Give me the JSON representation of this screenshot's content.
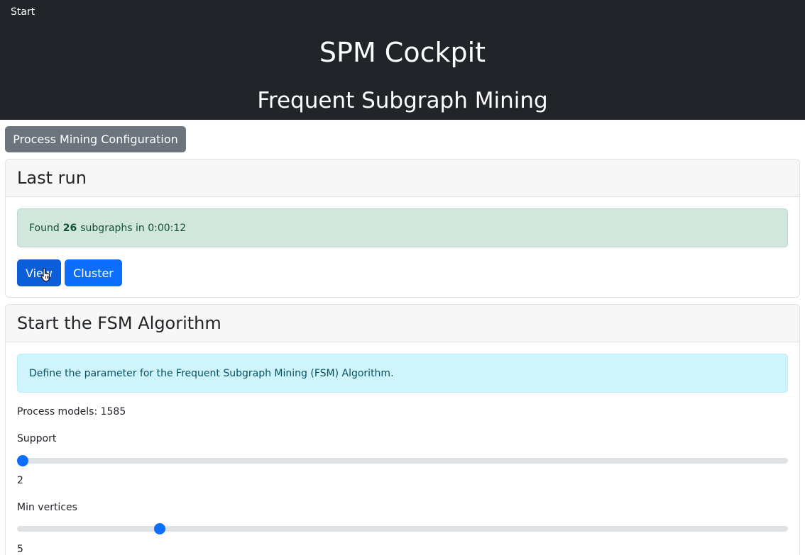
{
  "nav": {
    "start_label": "Start"
  },
  "header": {
    "title": "SPM Cockpit",
    "subtitle": "Frequent Subgraph Mining"
  },
  "config_button": {
    "label": "Process Mining Configuration"
  },
  "last_run": {
    "title": "Last run",
    "message_prefix": "Found",
    "count": "26",
    "message_suffix": "subgraphs in 0:00:12",
    "view_label": "View",
    "cluster_label": "Cluster"
  },
  "fsm": {
    "title": "Start the FSM Algorithm",
    "info": "Define the parameter for the Frequent Subgraph Mining (FSM) Algorithm.",
    "process_models": "Process models: 1585",
    "support": {
      "label": "Support",
      "value": "2",
      "level": 0.0
    },
    "min_vertices": {
      "label": "Min vertices",
      "value": "5",
      "level": 0.18
    }
  },
  "colors": {
    "header_bg": "#212529",
    "primary": "#0d6efd",
    "secondary": "#6c757d",
    "success_bg": "#d1e7dd",
    "info_bg": "#cff4fc"
  }
}
